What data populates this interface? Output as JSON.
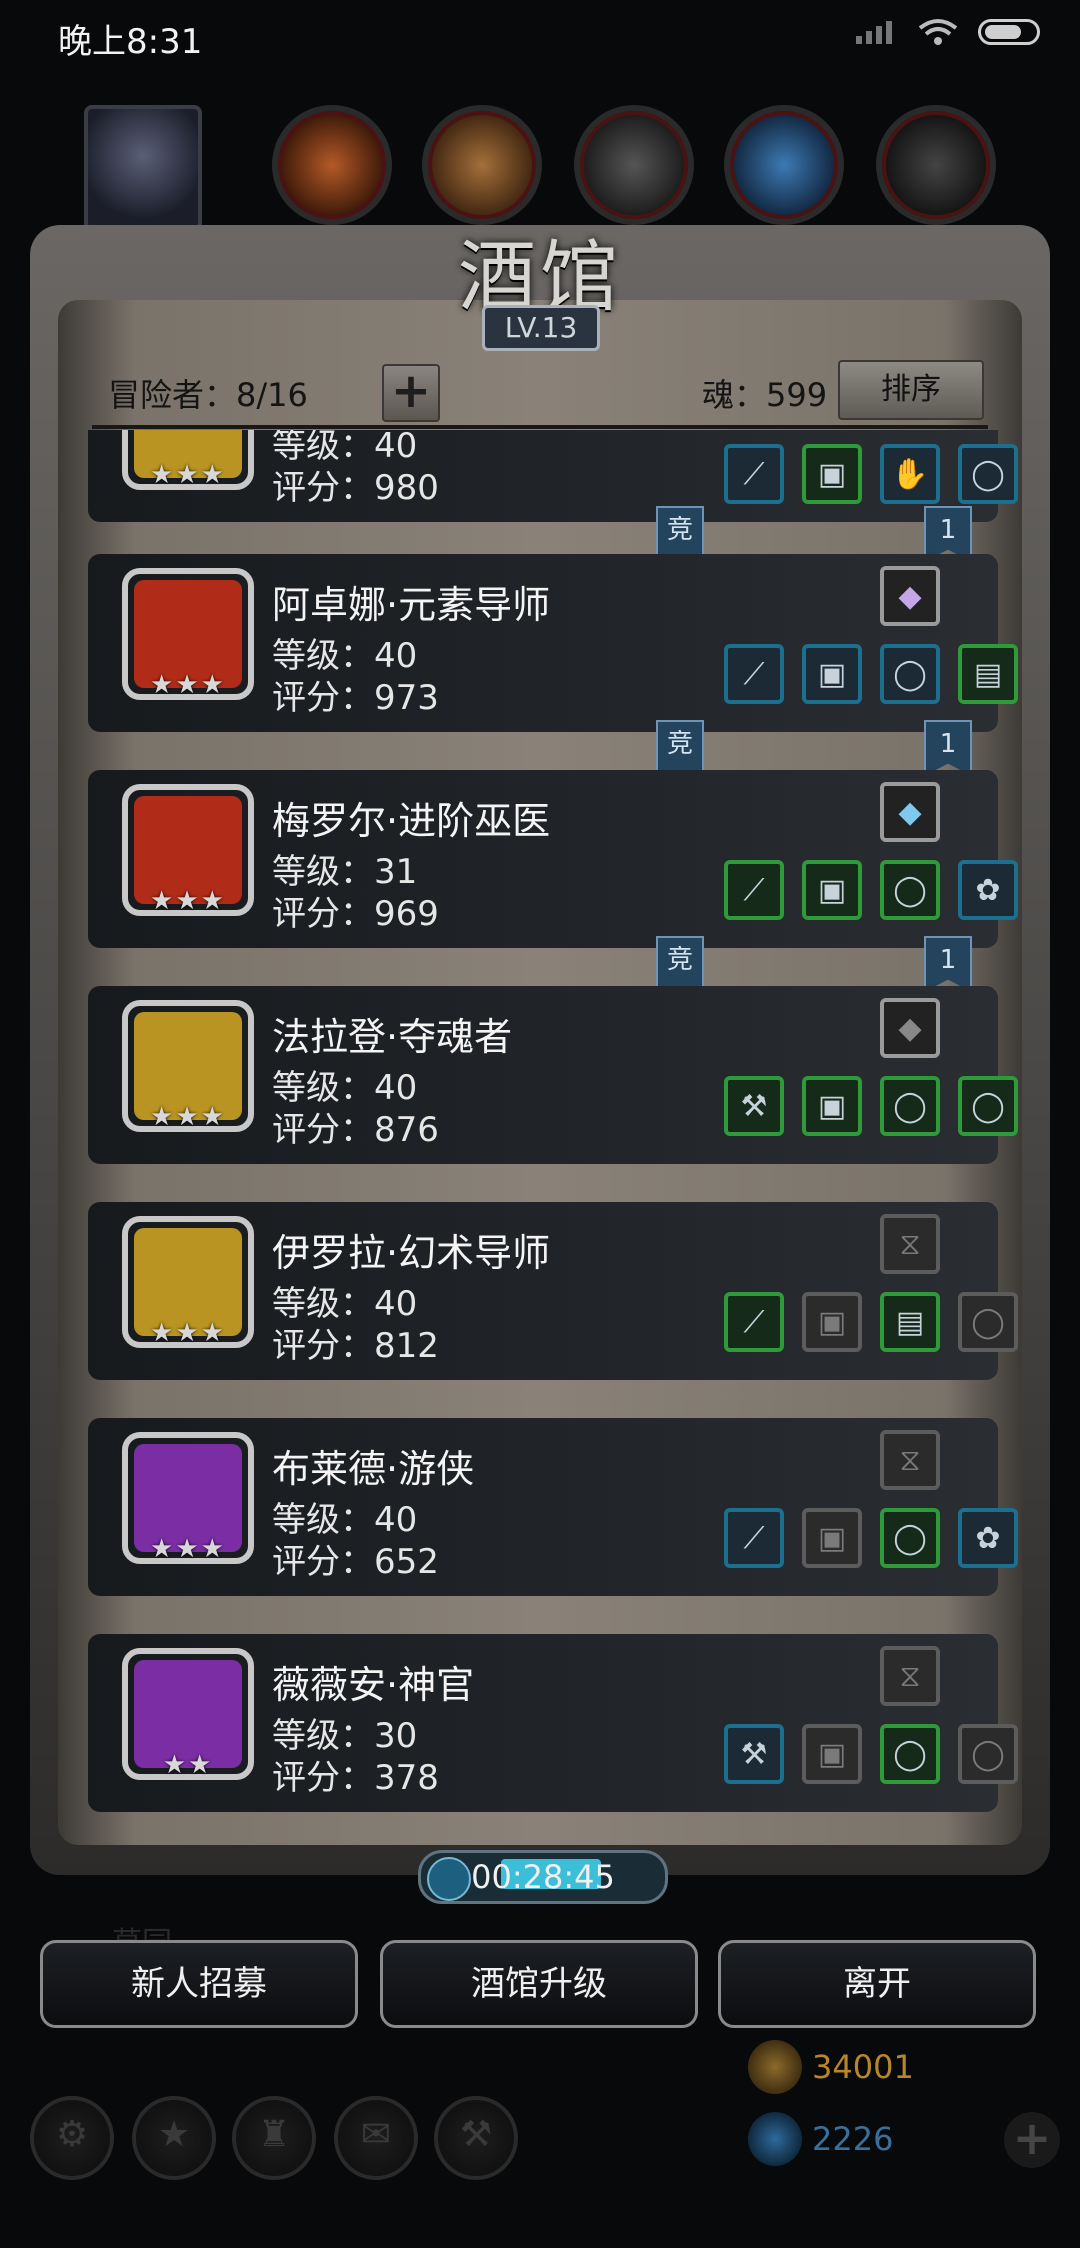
{
  "status": {
    "time": "晚上8:31"
  },
  "tavern": {
    "title": "酒馆",
    "level": "LV.13"
  },
  "header": {
    "adventurers": "冒险者：8/16",
    "plus": "+",
    "soul": "魂：599",
    "sort": "排序"
  },
  "partial_card": {
    "level": "等级：40",
    "score": "评分：980"
  },
  "tags": {
    "arena": "竞",
    "rank": "1"
  },
  "heroes": [
    {
      "name": "阿卓娜·元素导师",
      "level": "等级：40",
      "score": "评分：973",
      "stars": "★★★"
    },
    {
      "name": "梅罗尔·进阶巫医",
      "level": "等级：31",
      "score": "评分：969",
      "stars": "★★★"
    },
    {
      "name": "法拉登·夺魂者",
      "level": "等级：40",
      "score": "评分：876",
      "stars": "★★★"
    },
    {
      "name": "伊罗拉·幻术导师",
      "level": "等级：40",
      "score": "评分：812",
      "stars": "★★★"
    },
    {
      "name": "布莱德·游侠",
      "level": "等级：40",
      "score": "评分：652",
      "stars": "★★★"
    },
    {
      "name": "薇薇安·神官",
      "level": "等级：30",
      "score": "评分：378",
      "stars": "★★"
    }
  ],
  "timer": {
    "value": "00:28:45"
  },
  "buttons": {
    "recruit": "新人招募",
    "upgrade": "酒馆升级",
    "leave": "离开"
  },
  "faded": {
    "label": "草园"
  },
  "currency": {
    "gold": "34001",
    "gems": "2226"
  },
  "colors": {
    "gold_text": "#b8862a",
    "gem_text": "#3a6f9a",
    "slot_blue": "#1d6f8f",
    "slot_green": "#2f9a3a"
  }
}
